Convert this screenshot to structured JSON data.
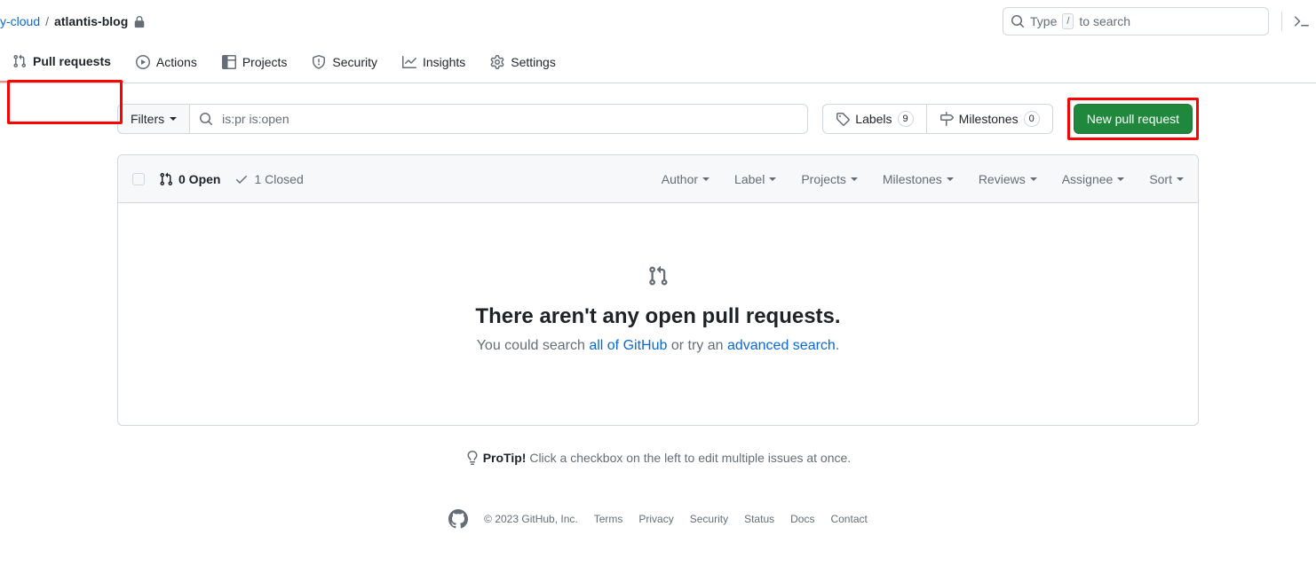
{
  "breadcrumb": {
    "org_fragment": "y-cloud",
    "sep": "/",
    "repo": "atlantis-blog"
  },
  "global_search": {
    "prefix": "Type",
    "key": "/",
    "suffix": "to search"
  },
  "nav": {
    "pull_requests": "Pull requests",
    "actions": "Actions",
    "projects": "Projects",
    "security": "Security",
    "insights": "Insights",
    "settings": "Settings"
  },
  "toolbar": {
    "filters": "Filters",
    "search_value": "is:pr is:open",
    "labels": "Labels",
    "labels_count": "9",
    "milestones": "Milestones",
    "milestones_count": "0",
    "new_pr": "New pull request"
  },
  "list_header": {
    "open": "0 Open",
    "closed": "1 Closed",
    "filters": {
      "author": "Author",
      "label": "Label",
      "projects": "Projects",
      "milestones": "Milestones",
      "reviews": "Reviews",
      "assignee": "Assignee",
      "sort": "Sort"
    }
  },
  "empty": {
    "title": "There aren't any open pull requests.",
    "desc_prefix": "You could search ",
    "link1": "all of GitHub",
    "desc_mid": " or try an ",
    "link2": "advanced search",
    "desc_suffix": "."
  },
  "protip": {
    "label": "ProTip!",
    "text": " Click a checkbox on the left to edit multiple issues at once."
  },
  "footer": {
    "copyright": "© 2023 GitHub, Inc.",
    "links": [
      "Terms",
      "Privacy",
      "Security",
      "Status",
      "Docs",
      "Contact"
    ]
  }
}
